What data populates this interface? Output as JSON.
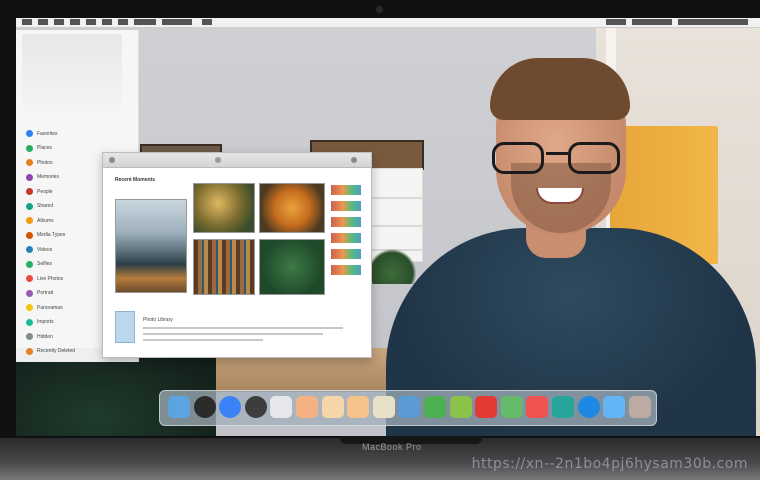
{
  "device": {
    "base_label": "MacBook Pro"
  },
  "watermark": {
    "url": "https://xn--2n1bo4pj6hysam30b.com"
  },
  "browser_window": {
    "content_title": "Recent Moments",
    "caption": "Photo Library"
  },
  "sidebar": {
    "items": [
      {
        "label": "Favorites",
        "color": "#2f80ed"
      },
      {
        "label": "Places",
        "color": "#27ae60"
      },
      {
        "label": "Photos",
        "color": "#e67e22"
      },
      {
        "label": "Memories",
        "color": "#8e44ad"
      },
      {
        "label": "People",
        "color": "#c0392b"
      },
      {
        "label": "Shared",
        "color": "#16a085"
      },
      {
        "label": "Albums",
        "color": "#f39c12"
      },
      {
        "label": "Media Types",
        "color": "#d35400"
      },
      {
        "label": "Videos",
        "color": "#2980b9"
      },
      {
        "label": "Selfies",
        "color": "#27ae60"
      },
      {
        "label": "Live Photos",
        "color": "#e74c3c"
      },
      {
        "label": "Portrait",
        "color": "#9b59b6"
      },
      {
        "label": "Panoramas",
        "color": "#f1c40f"
      },
      {
        "label": "Imports",
        "color": "#1abc9c"
      },
      {
        "label": "Hidden",
        "color": "#7f8c8d"
      },
      {
        "label": "Recently Deleted",
        "color": "#e67e22"
      }
    ]
  },
  "dock": {
    "icons": [
      {
        "name": "finder-icon",
        "color": "#5ba4e0"
      },
      {
        "name": "launchpad-icon",
        "color": "#2b2b2b"
      },
      {
        "name": "safari-icon",
        "color": "#3b82f6"
      },
      {
        "name": "camera-icon",
        "color": "#3d3d3d"
      },
      {
        "name": "photos-icon",
        "color": "#e5e7eb"
      },
      {
        "name": "notes-icon",
        "color": "#f4b183"
      },
      {
        "name": "reminders-icon",
        "color": "#f6d6a8"
      },
      {
        "name": "calendar-icon",
        "color": "#f5c28a"
      },
      {
        "name": "books-icon",
        "color": "#e7e1c8"
      },
      {
        "name": "app-store-icon",
        "color": "#5b9bd5"
      },
      {
        "name": "messages-icon",
        "color": "#4caf50"
      },
      {
        "name": "maps-icon",
        "color": "#8bc34a"
      },
      {
        "name": "music-icon",
        "color": "#e53935"
      },
      {
        "name": "facetime-icon",
        "color": "#66bb6a"
      },
      {
        "name": "news-icon",
        "color": "#ef5350"
      },
      {
        "name": "settings-icon",
        "color": "#26a69a"
      },
      {
        "name": "mail-icon",
        "color": "#1e88e5"
      },
      {
        "name": "folder-icon",
        "color": "#64b5f6"
      },
      {
        "name": "trash-icon",
        "color": "#bcaaa4"
      }
    ]
  }
}
